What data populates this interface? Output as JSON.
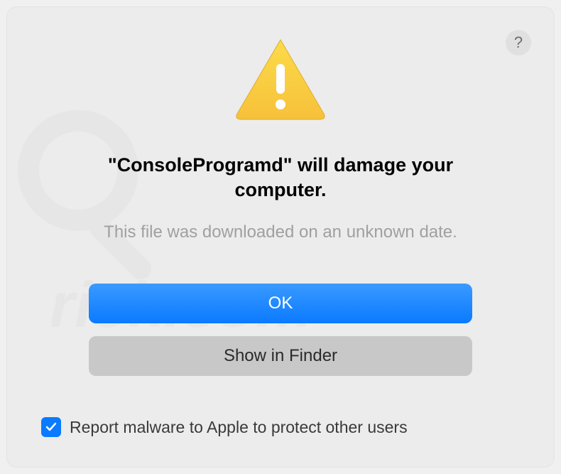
{
  "dialog": {
    "title_prefix": "\"",
    "title_app": "ConsoleProgramd",
    "title_suffix": "\" will damage your computer.",
    "subtitle": "This file was downloaded on an unknown date.",
    "help_label": "?",
    "primary_button": "OK",
    "secondary_button": "Show in Finder",
    "checkbox_label": "Report malware to Apple to protect other users",
    "checkbox_checked": true
  }
}
